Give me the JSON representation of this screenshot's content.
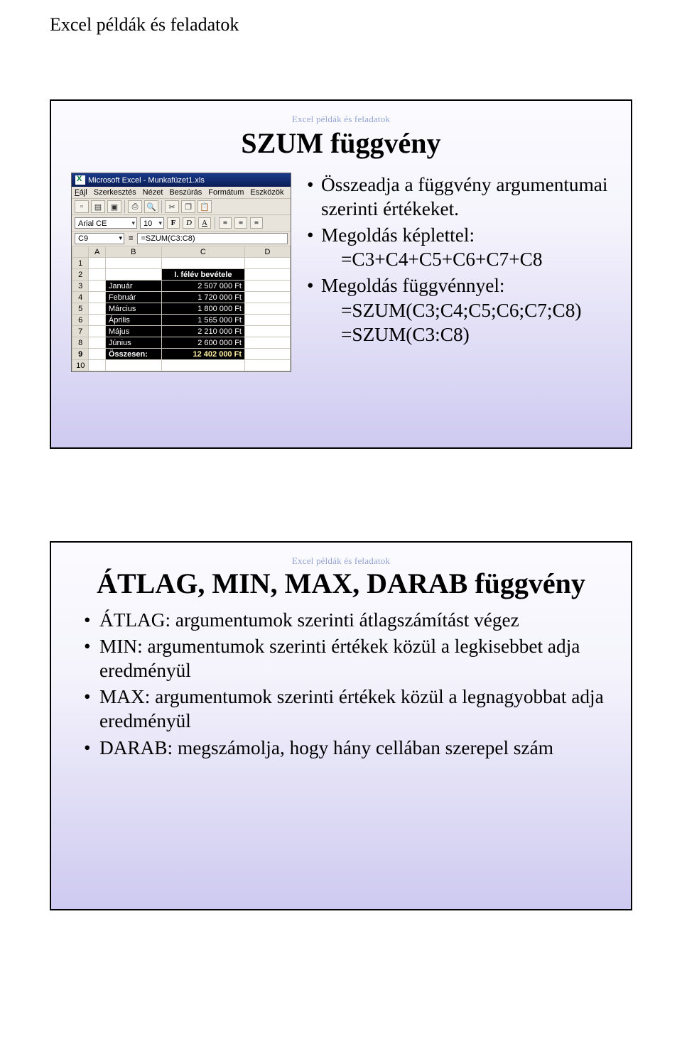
{
  "page_header": "Excel példák és feladatok",
  "eyebrow": "Excel példák és feladatok",
  "slide1": {
    "title": "SZUM függvény",
    "bullets": {
      "b1": "Összeadja a függvény argumentumai szerinti értékeket.",
      "b2": "Megoldás képlettel:",
      "b2a": "=C3+C4+C5+C6+C7+C8",
      "b3": "Megoldás függvénnyel:",
      "b3a": "=SZUM(C3;C4;C5;C6;C7;C8)",
      "b3b": "=SZUM(C3:C8)"
    }
  },
  "excel": {
    "titlebar": "Microsoft Excel - Munkafüzet1.xls",
    "menu": {
      "fajl": "Fájl",
      "szerk": "Szerkesztés",
      "nezet": "Nézet",
      "beszuras": "Beszúrás",
      "formatum": "Formátum",
      "eszkozok": "Eszközök"
    },
    "font_name": "Arial CE",
    "font_size": "10",
    "namebox": "C9",
    "formula": "=SZUM(C3:C8)",
    "cols": {
      "A": "A",
      "B": "B",
      "C": "C",
      "D": "D"
    },
    "header_label": "I. félév bevétele",
    "rows": [
      {
        "n": "1",
        "b": "",
        "c": ""
      },
      {
        "n": "2",
        "b": "",
        "c": "I. félév bevétele"
      },
      {
        "n": "3",
        "b": "Január",
        "c": "2 507 000 Ft"
      },
      {
        "n": "4",
        "b": "Február",
        "c": "1 720 000 Ft"
      },
      {
        "n": "5",
        "b": "Március",
        "c": "1 800 000 Ft"
      },
      {
        "n": "6",
        "b": "Április",
        "c": "1 565 000 Ft"
      },
      {
        "n": "7",
        "b": "Május",
        "c": "2 210 000 Ft"
      },
      {
        "n": "8",
        "b": "Június",
        "c": "2 600 000 Ft"
      },
      {
        "n": "9",
        "b": "Összesen:",
        "c": "12 402 000 Ft"
      },
      {
        "n": "10",
        "b": "",
        "c": ""
      }
    ]
  },
  "slide2": {
    "title": "ÁTLAG, MIN, MAX, DARAB függvény",
    "b1": "ÁTLAG: argumentumok szerinti átlagszámítást végez",
    "b2": "MIN: argumentumok szerinti értékek közül a legkisebbet adja eredményül",
    "b3": "MAX: argumentumok szerinti értékek közül a legnagyobbat adja eredményül",
    "b4": "DARAB: megszámolja, hogy hány cellában szerepel szám"
  }
}
